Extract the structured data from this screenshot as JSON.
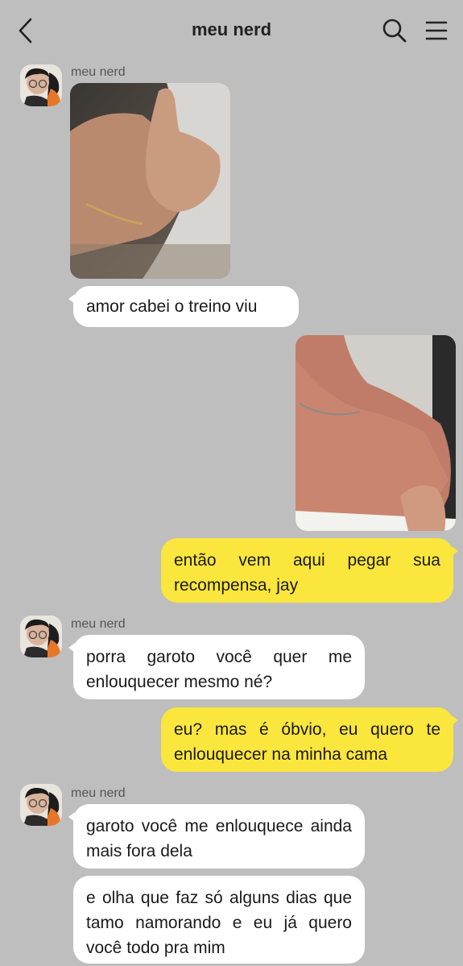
{
  "header": {
    "title": "meu nerd",
    "back_icon": "chevron-left-icon",
    "search_icon": "search-icon",
    "menu_icon": "hamburger-menu-icon"
  },
  "messages": [
    {
      "type": "incoming",
      "sender": "meu nerd",
      "content": "photo",
      "photo_subject": "arm thumbs up"
    },
    {
      "type": "incoming",
      "text": "amor cabei o treino viu"
    },
    {
      "type": "outgoing",
      "content": "photo",
      "photo_subject": "shoulder with necklace"
    },
    {
      "type": "outgoing",
      "text": "então vem aqui pegar sua recompensa, jay"
    },
    {
      "type": "incoming",
      "sender": "meu nerd",
      "text": "porra garoto você quer me enlouquecer mesmo né?"
    },
    {
      "type": "outgoing",
      "text": "eu? mas é óbvio, eu quero te enlouquecer na minha cama"
    },
    {
      "type": "incoming",
      "sender": "meu nerd",
      "text": "garoto você me enlouquece ainda mais fora dela"
    },
    {
      "type": "incoming",
      "text": "e olha que faz só alguns dias que tamo namorando e eu já quero você todo pra mim"
    }
  ],
  "colors": {
    "background": "#bebebe",
    "incoming_bubble": "#ffffff",
    "outgoing_bubble": "#fbe63d"
  }
}
